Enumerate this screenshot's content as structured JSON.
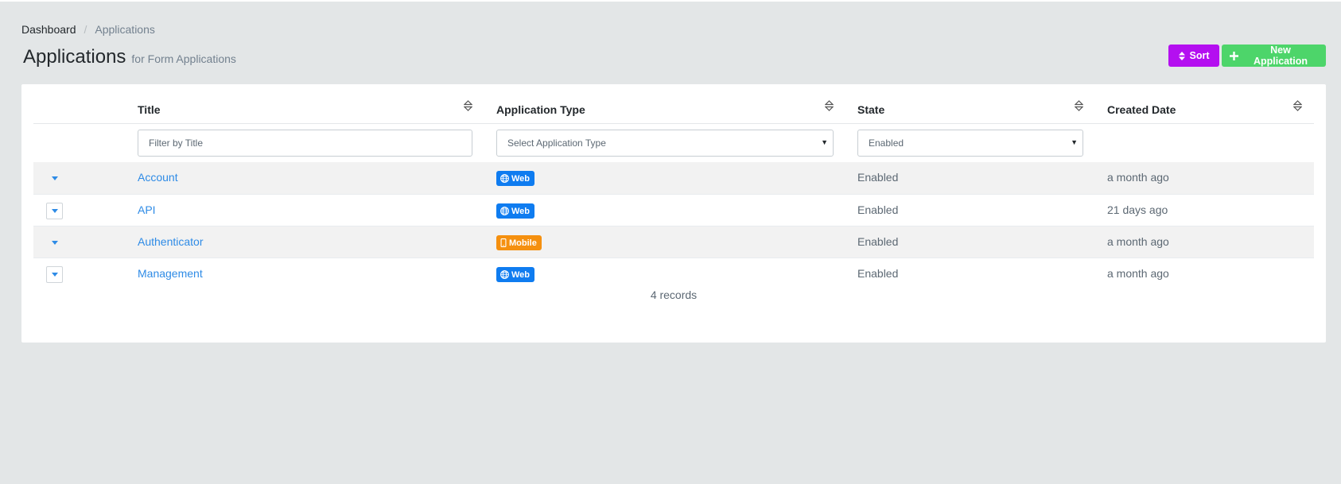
{
  "breadcrumb": {
    "root": "Dashboard",
    "separator": "/",
    "current": "Applications"
  },
  "page": {
    "title": "Applications",
    "subtitle": "for Form Applications"
  },
  "actions": {
    "sort_label": "Sort",
    "new_label": "New Application"
  },
  "table": {
    "columns": [
      "Title",
      "Application Type",
      "State",
      "Created Date"
    ],
    "filters": {
      "title_placeholder": "Filter by Title",
      "type_selected": "Select Application Type",
      "state_selected": "Enabled"
    },
    "rows": [
      {
        "title": "Account",
        "type": "Web",
        "state": "Enabled",
        "created": "a month ago"
      },
      {
        "title": "API",
        "type": "Web",
        "state": "Enabled",
        "created": "21 days ago"
      },
      {
        "title": "Authenticator",
        "type": "Mobile",
        "state": "Enabled",
        "created": "a month ago"
      },
      {
        "title": "Management",
        "type": "Web",
        "state": "Enabled",
        "created": "a month ago"
      }
    ],
    "record_count": "4 records"
  },
  "colors": {
    "sort_button": "#b40ff0",
    "new_button": "#4dd56a",
    "web_badge": "#0f7cf0",
    "mobile_badge": "#f5900f",
    "link": "#2e8be6"
  },
  "icons": {
    "sort": "sort-icon",
    "add": "plus-icon",
    "web": "globe-icon",
    "mobile": "mobile-icon",
    "expand": "caret-down-icon"
  }
}
